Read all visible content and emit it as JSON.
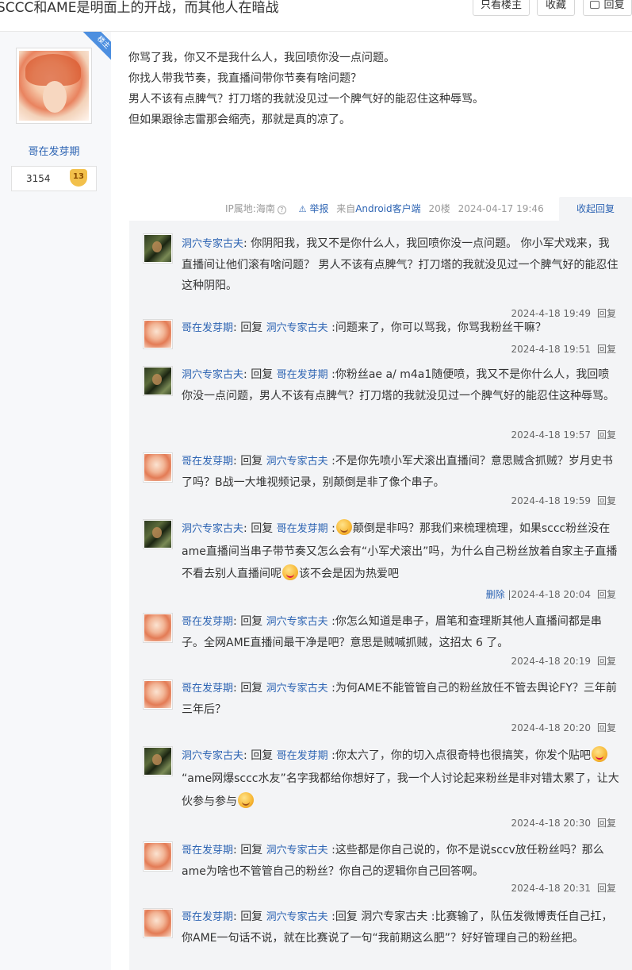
{
  "header": {
    "title": "SCCC和AME是明面上的开战，而其他人在暗战",
    "btn_louzhu": "只看楼主",
    "btn_fav": "收藏",
    "btn_reply": "回复"
  },
  "author": {
    "badge": "楼主",
    "name": "哥在发芽期",
    "level_value": "3154",
    "level_badge": "13"
  },
  "post": {
    "lines": [
      "你骂了我，你又不是我什么人，我回喷你没一点问题。",
      "你找人带我节奏，我直播间带你节奏有啥问题？",
      "男人不该有点脾气？打刀塔的我就没见过一个脾气好的能忍住这种辱骂。",
      "但如果跟徐志雷那会缩壳，那就是真的凉了。"
    ],
    "ip": "IP属地:海南",
    "report": "举报",
    "from_prefix": "来自",
    "client": "Android客户端",
    "floor": "20楼",
    "time": "2024-04-17 19:46",
    "collapse": "收起回复"
  },
  "replies": [
    {
      "user": "洞穴专家古夫",
      "reply_word": "",
      "target": "",
      "text": "你阴阳我，我又不是你什么人，我回喷你没一点问题。 你小军犬戏来，我直播间让他们滚有啥问题？ 男人不该有点脾气？打刀塔的我就没见过一个脾气好的能忍住这种阴阳。",
      "time": "2024-4-18 19:49",
      "action": "回复"
    },
    {
      "user": "哥在发芽期",
      "reply_word": "回复",
      "target": "洞穴专家古夫",
      "text": ":问题来了，你可以骂我，你骂我粉丝干嘛？",
      "time": "2024-4-18 19:51",
      "action": "回复"
    },
    {
      "user": "洞穴专家古夫",
      "reply_word": "回复",
      "target": "哥在发芽期",
      "text": ":你粉丝ae a/ m4a1随便喷，我又不是你什么人，我回喷你没一点问题，男人不该有点脾气？打刀塔的我就没见过一个脾气好的能忍住这种辱骂。",
      "time": "2024-4-18 19:57",
      "action": "回复"
    },
    {
      "user": "哥在发芽期",
      "reply_word": "回复",
      "target": "洞穴专家古夫",
      "text": ":不是你先喷小军犬滚出直播间？意思贼含抓贼？岁月史书了吗？B战一大堆视频记录，别颠倒是非了像个串子。",
      "time": "2024-4-18 19:59",
      "action": "回复"
    },
    {
      "user": "洞穴专家古夫",
      "reply_word": "回复",
      "target": "哥在发芽期",
      "text_a": ":",
      "text_b": "颠倒是非吗？那我们来梳理梳理，如果sccc粉丝没在ame直播间当串子带节奏又怎么会有“小军犬滚出”吗，为什么自己粉丝放着自家主子直播不看去别人直播间呢",
      "text_c": "该不会是因为热爱吧",
      "delete": "删除",
      "time": "|2024-4-18 20:04",
      "action": "回复"
    },
    {
      "user": "哥在发芽期",
      "reply_word": "回复",
      "target": "洞穴专家古夫",
      "text": ":你怎么知道是串子，眉笔和查理斯其他人直播间都是串子。全网AME直播间最干净是吧？意思是贼喊抓贼，这招太 6 了。",
      "time": "2024-4-18 20:19",
      "action": "回复"
    },
    {
      "user": "哥在发芽期",
      "reply_word": "回复",
      "target": "洞穴专家古夫",
      "text": ":为何AME不能管管自己的粉丝放任不管去舆论FY？三年前三年后？",
      "time": "2024-4-18 20:20",
      "action": "回复"
    },
    {
      "user": "洞穴专家古夫",
      "reply_word": "回复",
      "target": "哥在发芽期",
      "text_a": ":你太六了，你的切入点很奇特也很搞笑，你发个贴吧",
      "text_b": "“ame网爆sccc水友”名字我都给你想好了，我一个人讨论起来粉丝是非对错太累了，让大伙参与参与",
      "time": "2024-4-18 20:30",
      "action": "回复"
    },
    {
      "user": "哥在发芽期",
      "reply_word": "回复",
      "target": "洞穴专家古夫",
      "text": ":这些都是你自己说的，你不是说sccv放任粉丝吗？那么ame为啥也不管管自己的粉丝？你自己的逻辑你自己回答啊。",
      "time": "2024-4-18 20:31",
      "action": "回复"
    },
    {
      "user": "哥在发芽期",
      "reply_word": "回复",
      "target": "洞穴专家古夫",
      "text": ":回复 洞穴专家古夫 :比赛输了，队伍发微博责任自己扛，你AME一句话不说，就在比赛说了一句“我前期这么肥”？好好管理自己的粉丝把。"
    }
  ]
}
